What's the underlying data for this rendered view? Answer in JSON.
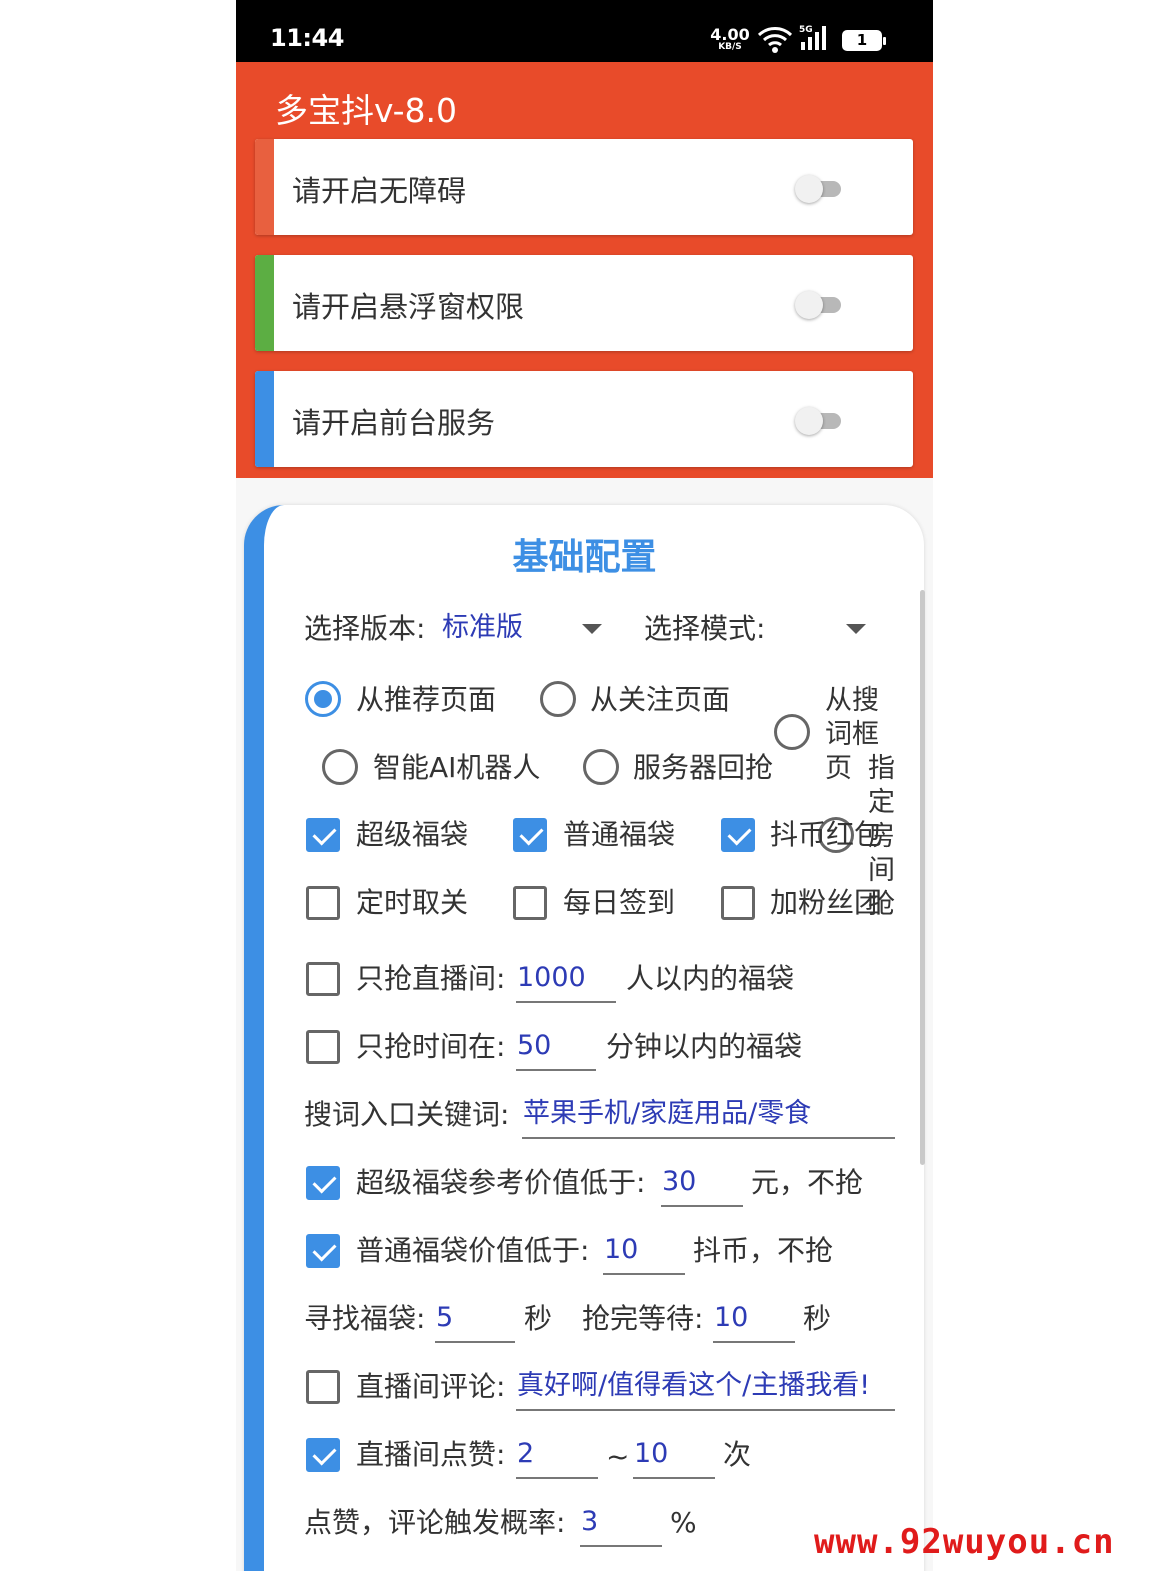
{
  "status_bar": {
    "time": "11:44",
    "net_speed": "4.00",
    "net_unit": "KB/S",
    "network_type": "5G",
    "battery": "1"
  },
  "app": {
    "title": "多宝抖v-8.0"
  },
  "permissions": [
    {
      "label": "请开启无障碍",
      "stripe_color": "#e8603f",
      "enabled": false
    },
    {
      "label": "请开启悬浮窗权限",
      "stripe_color": "#5cae43",
      "enabled": false
    },
    {
      "label": "请开启前台服务",
      "stripe_color": "#3d8fe4",
      "enabled": false
    }
  ],
  "config": {
    "title": "基础配置",
    "version_label": "选择版本:",
    "version_value": "标准版",
    "mode_label": "选择模式:",
    "mode_value": "",
    "entry_radios": [
      {
        "label": "从推荐页面",
        "selected": true
      },
      {
        "label": "从关注页面",
        "selected": false
      },
      {
        "label": "从搜词框页",
        "selected": false
      },
      {
        "label": "智能AI机器人",
        "selected": false
      },
      {
        "label": "服务器回抢",
        "selected": false
      },
      {
        "label": "指定房间抢",
        "selected": false
      }
    ],
    "type_checks": [
      {
        "label": "超级福袋",
        "checked": true
      },
      {
        "label": "普通福袋",
        "checked": true
      },
      {
        "label": "抖币红包",
        "checked": true
      },
      {
        "label": "定时取关",
        "checked": false
      },
      {
        "label": "每日签到",
        "checked": false
      },
      {
        "label": "加粉丝团",
        "checked": false
      }
    ],
    "live_limit": {
      "checked": false,
      "label": "只抢直播间:",
      "value": "1000",
      "suffix": "人以内的福袋"
    },
    "time_limit": {
      "checked": false,
      "label": "只抢时间在:",
      "value": "50",
      "suffix": "分钟以内的福袋"
    },
    "keywords": {
      "label": "搜词入口关键词:",
      "value": "苹果手机/家庭用品/零食"
    },
    "super_value": {
      "checked": true,
      "label": "超级福袋参考价值低于:",
      "value": "30",
      "suffix": "元，不抢"
    },
    "normal_value": {
      "checked": true,
      "label": "普通福袋价值低于:",
      "value": "10",
      "suffix": "抖币，不抢"
    },
    "find": {
      "label": "寻找福袋:",
      "value": "5",
      "unit": "秒"
    },
    "wait": {
      "label": "抢完等待:",
      "value": "10",
      "unit": "秒"
    },
    "comment": {
      "checked": false,
      "label": "直播间评论:",
      "value": "真好啊/值得看这个/主播我看!"
    },
    "likes": {
      "checked": true,
      "label": "直播间点赞:",
      "min": "2",
      "sep": "~",
      "max": "10",
      "unit": "次"
    },
    "probability": {
      "label": "点赞，评论触发概率:",
      "value": "3",
      "unit": "%"
    }
  },
  "watermark": "www.92wuyou.cn",
  "colors": {
    "header": "#e84b2a",
    "accent": "#3d8fe4",
    "value_text": "#2d3bb5"
  }
}
